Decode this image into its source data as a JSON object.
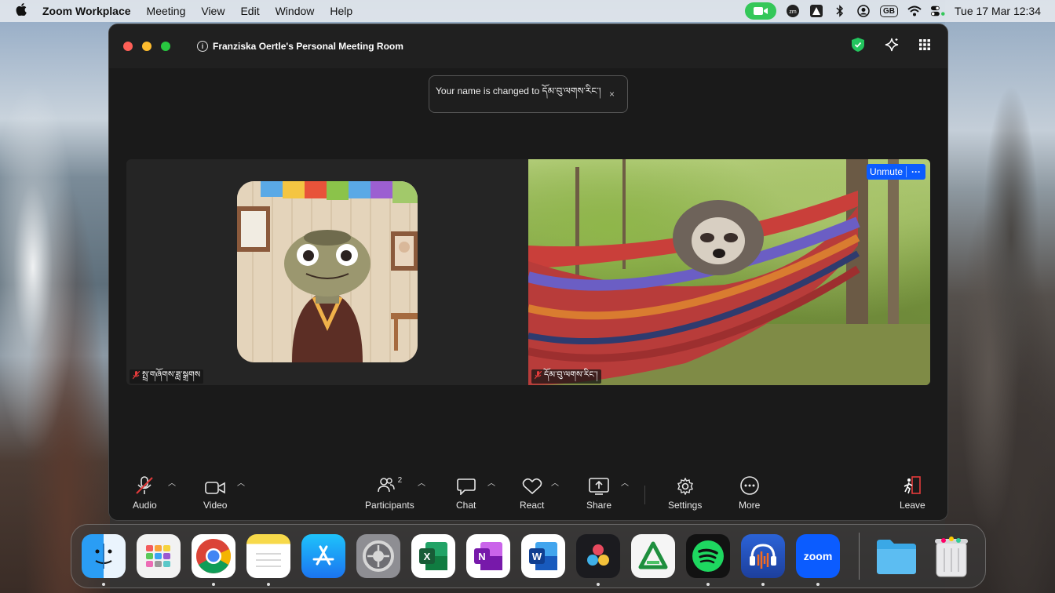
{
  "menubar": {
    "app_name": "Zoom Workplace",
    "items": [
      "Meeting",
      "View",
      "Edit",
      "Window",
      "Help"
    ],
    "keyboard_badge": "GB",
    "clock": "Tue 17 Mar  12:34"
  },
  "window": {
    "title": "Franziska Oertle's Personal Meeting Room"
  },
  "toast": {
    "text": "Your name is changed to དོམ་བུ་ལགས་རིང་།",
    "close": "×"
  },
  "participants": {
    "left_name": "སྤྲ་གཞོགས་ཟླ་སྒྲགས",
    "right_name": "དོམ་བུ་ལགས་རིང་།",
    "unmute_label": "Unmute",
    "more_label": "···"
  },
  "toolbar": {
    "audio": "Audio",
    "video": "Video",
    "participants": "Participants",
    "participants_count": "2",
    "chat": "Chat",
    "react": "React",
    "share": "Share",
    "settings": "Settings",
    "more": "More",
    "leave": "Leave"
  },
  "dock": {
    "apps": [
      "Finder",
      "Launchpad",
      "Chrome",
      "Notes",
      "App Store",
      "System Settings",
      "Excel",
      "OneNote",
      "Word",
      "DaVinci Resolve",
      "Affinity",
      "Spotify",
      "Audacity",
      "Zoom",
      "Folder",
      "Trash"
    ],
    "zoom_label": "zoom"
  }
}
